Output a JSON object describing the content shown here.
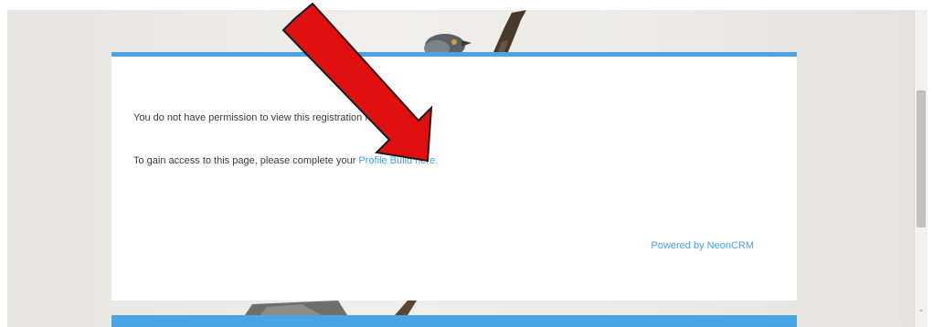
{
  "card": {
    "message_line1": "You do not have permission to view this registration form.",
    "message_line2_prefix": "To gain access to this page, please complete your ",
    "profile_link": "Profile Build here.",
    "powered_by": "Powered by NeonCRM"
  },
  "scrollbar": {
    "down_arrow_glyph": "⌄"
  },
  "colors": {
    "accent": "#4aa3e3",
    "link": "#4a9fdc",
    "arrow": "#e01010"
  },
  "icons": {
    "annotation": "red-arrow-icon",
    "scroll_down": "chevron-down-icon"
  }
}
